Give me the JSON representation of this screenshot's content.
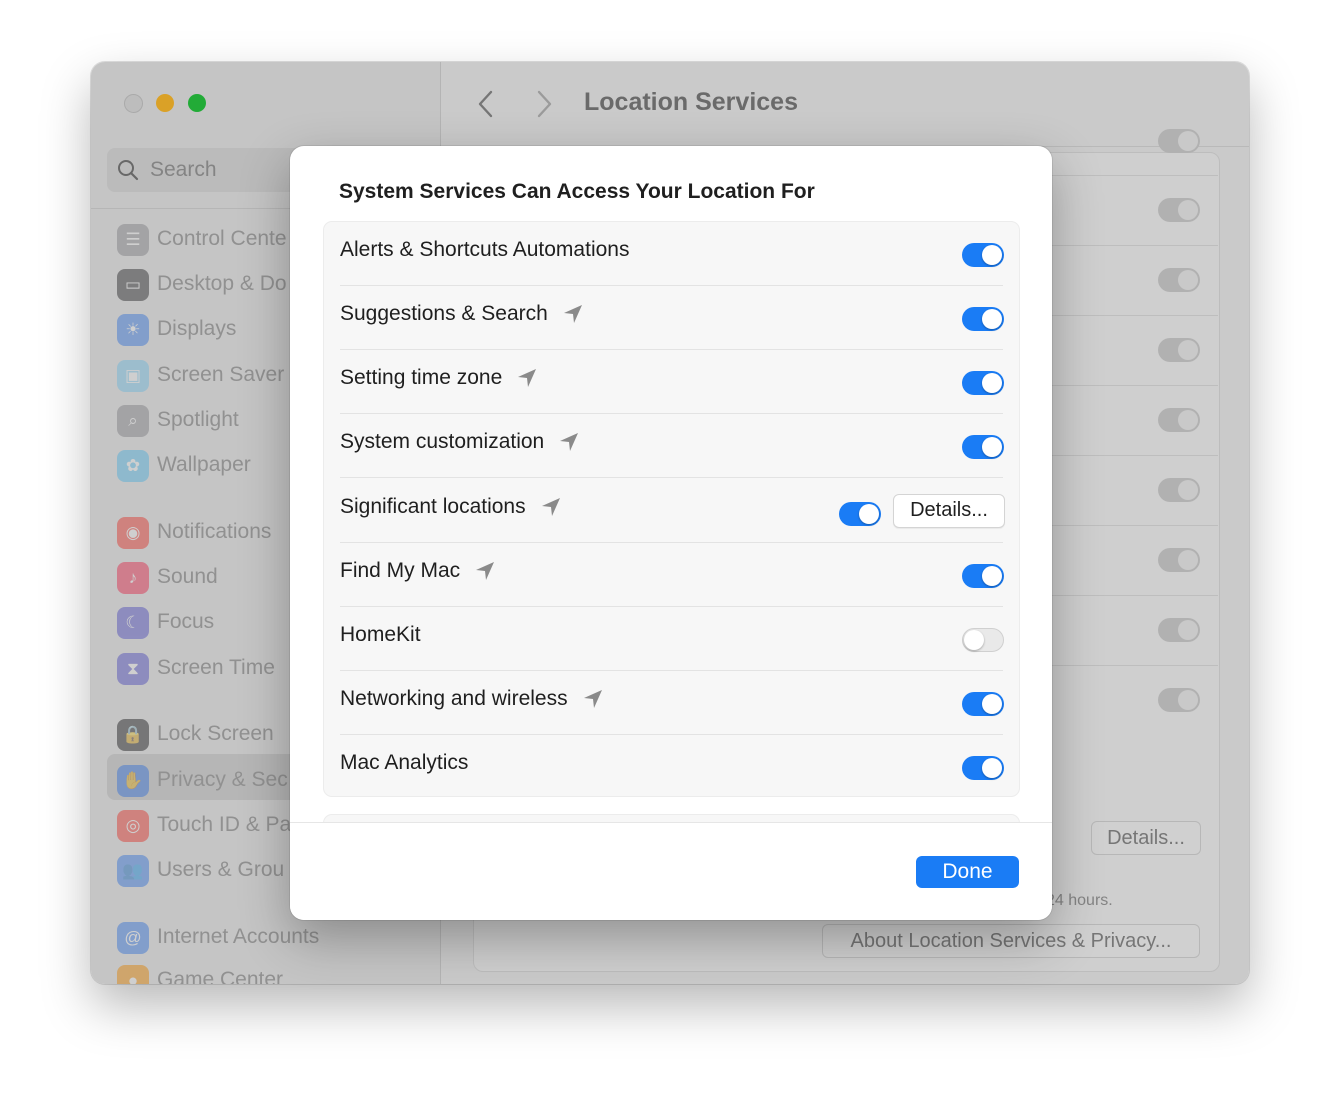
{
  "window": {
    "title": "Location Services"
  },
  "sidebar": {
    "search_placeholder": "Search",
    "items": [
      {
        "label": "Control Cente",
        "icon": "control-center-icon",
        "color": "#8e8e93"
      },
      {
        "label": "Desktop & Do",
        "icon": "desktop-dock-icon",
        "color": "#2c2c2e"
      },
      {
        "label": "Displays",
        "icon": "displays-icon",
        "color": "#3b82f6"
      },
      {
        "label": "Screen Saver",
        "icon": "screen-saver-icon",
        "color": "#7dd3fc"
      },
      {
        "label": "Spotlight",
        "icon": "spotlight-icon",
        "color": "#8e8e93"
      },
      {
        "label": "Wallpaper",
        "icon": "wallpaper-icon",
        "color": "#5ac8fa"
      },
      {
        "label": "Notifications",
        "icon": "notifications-icon",
        "color": "#ff3b30"
      },
      {
        "label": "Sound",
        "icon": "sound-icon",
        "color": "#ff2d55"
      },
      {
        "label": "Focus",
        "icon": "focus-icon",
        "color": "#5856d6"
      },
      {
        "label": "Screen Time",
        "icon": "screen-time-icon",
        "color": "#5856d6"
      },
      {
        "label": "Lock Screen",
        "icon": "lock-screen-icon",
        "color": "#1c1c1e"
      },
      {
        "label": "Privacy & Sec",
        "icon": "privacy-hand-icon",
        "color": "#3b82f6"
      },
      {
        "label": "Touch ID & Pa",
        "icon": "touch-id-icon",
        "color": "#ff3b30"
      },
      {
        "label": "Users & Grou",
        "icon": "users-groups-icon",
        "color": "#3b82f6"
      },
      {
        "label": "Internet Accounts",
        "icon": "internet-accounts-icon",
        "color": "#3b82f6"
      },
      {
        "label": "Game Center",
        "icon": "game-center-icon",
        "color": "#ff9500"
      }
    ]
  },
  "main": {
    "details_label": "Details...",
    "note": "24 hours.",
    "about_label": "About Location Services & Privacy..."
  },
  "modal": {
    "title": "System Services Can Access Your Location For",
    "rows": [
      {
        "label": "Alerts & Shortcuts Automations",
        "arrow": false,
        "enabled": true
      },
      {
        "label": "Suggestions & Search",
        "arrow": true,
        "enabled": true
      },
      {
        "label": "Setting time zone",
        "arrow": true,
        "enabled": true
      },
      {
        "label": "System customization",
        "arrow": true,
        "enabled": true
      },
      {
        "label": "Significant locations",
        "arrow": true,
        "enabled": true,
        "details": "Details..."
      },
      {
        "label": "Find My Mac",
        "arrow": true,
        "enabled": true
      },
      {
        "label": "HomeKit",
        "arrow": false,
        "enabled": false
      },
      {
        "label": "Networking and wireless",
        "arrow": true,
        "enabled": true
      },
      {
        "label": "Mac Analytics",
        "arrow": false,
        "enabled": true
      }
    ],
    "done_label": "Done"
  },
  "colors": {
    "accent": "#1a7cf5",
    "arrow": "#8a8a8a"
  }
}
